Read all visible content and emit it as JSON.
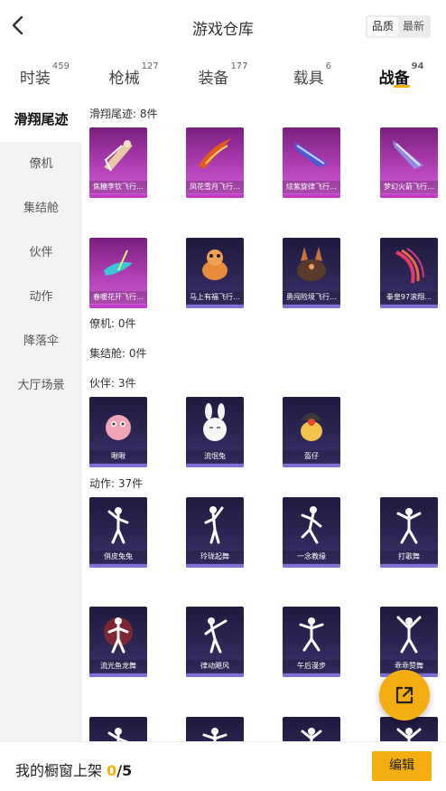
{
  "header": {
    "title": "游戏仓库",
    "sort_options": [
      "品质",
      "最新"
    ],
    "sort_selected": "品质"
  },
  "tabs": [
    {
      "label": "时装",
      "count": "459"
    },
    {
      "label": "枪械",
      "count": "127"
    },
    {
      "label": "装备",
      "count": "177"
    },
    {
      "label": "载具",
      "count": "6"
    },
    {
      "label": "战备",
      "count": "94",
      "active": true
    }
  ],
  "sidebar": {
    "items": [
      "滑翔尾迹",
      "僚机",
      "集结舱",
      "伙伴",
      "动作",
      "降落伞",
      "大厅场景"
    ],
    "active": "滑翔尾迹"
  },
  "sections": {
    "glide": {
      "title": "滑翔尾迹: 8件",
      "items": [
        "焦糖李钦飞行…",
        "凤花雪月飞行…",
        "炫紫旋律飞行…",
        "梦幻火箭飞行…",
        "春暖花开飞行…",
        "马上有福飞行…",
        "勇闯险境飞行…",
        "拳皇97滚翔…"
      ]
    },
    "wingman": {
      "title": "僚机: 0件"
    },
    "capsule": {
      "title": "集结舱: 0件"
    },
    "partner": {
      "title": "伙伴: 3件",
      "items": [
        "啾啾",
        "流氓兔",
        "盔仔"
      ]
    },
    "action": {
      "title": "动作: 37件",
      "items": [
        "俏皮兔兔",
        "玲珑起舞",
        "一念教缘",
        "打歌舞",
        "流光鱼龙舞",
        "律动飓风",
        "午后漫步",
        "乖乖赞舞"
      ]
    }
  },
  "footer": {
    "label": "我的橱窗上架",
    "current": "0",
    "total": "/5",
    "edit_label": "编辑"
  },
  "colors": {
    "accent": "#f5ae12",
    "legendary_card": "#b13fb5",
    "epic_card": "#2e2757"
  }
}
